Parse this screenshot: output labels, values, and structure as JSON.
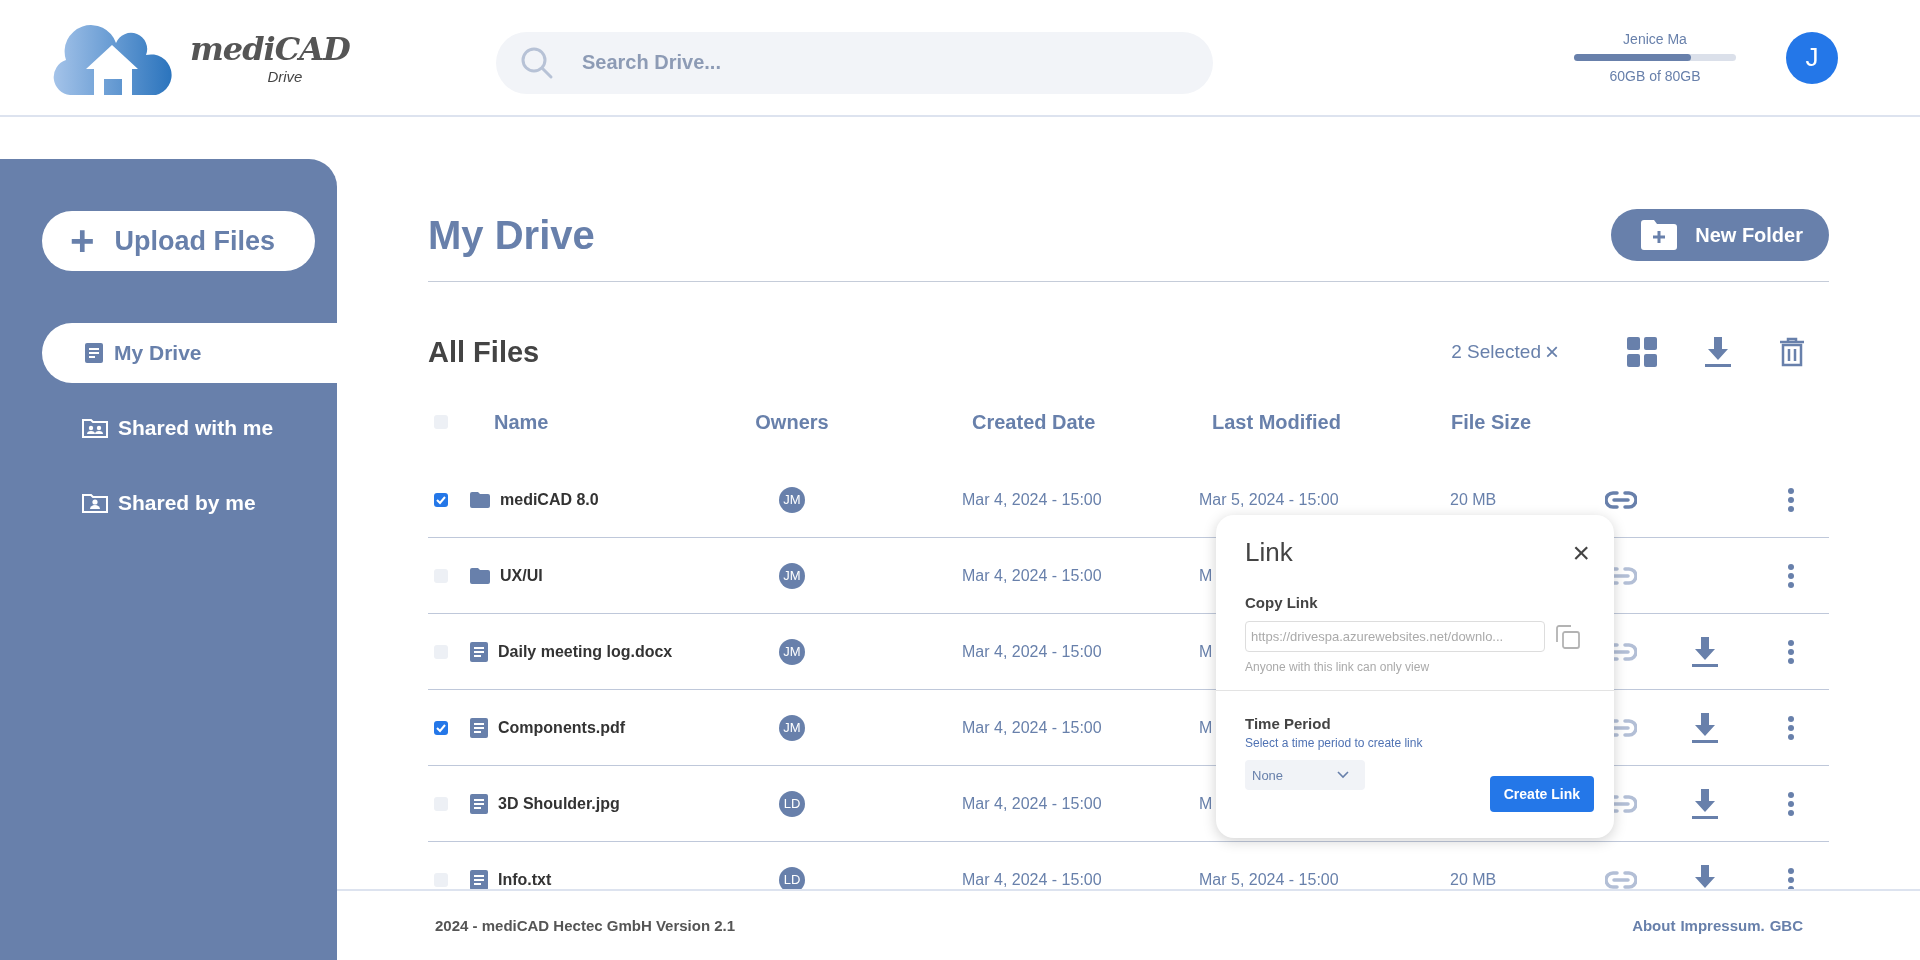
{
  "header": {
    "logo": {
      "name": "mediCAD",
      "subtitle": "Drive"
    },
    "search": {
      "placeholder": "Search Drive..."
    },
    "user": {
      "name": "Jenice Ma",
      "storage": {
        "level": 0.72
      },
      "storage_text": "60GB of 80GB",
      "avatar": "J"
    }
  },
  "sidebar": {
    "upload_button": {
      "label": "Upload Files",
      "icon": "+"
    },
    "items": [
      {
        "label": "My Drive",
        "kind": "document",
        "selected": true
      },
      {
        "label": "Shared with me",
        "kind": "shared-with",
        "selected": false
      },
      {
        "label": "Shared by me",
        "kind": "shared-by",
        "selected": false
      }
    ]
  },
  "page": {
    "title": "My Drive",
    "new_folder_button": "New Folder"
  },
  "files": {
    "title": "All Files",
    "selection": {
      "text": "2 Selected",
      "clear": "×"
    },
    "columns": [
      "Name",
      "Owners",
      "Created Date",
      "Last Modified",
      "File Size"
    ],
    "header_checked": false,
    "rows": [
      {
        "checked": true,
        "kind": "folder",
        "name": "mediCAD 8.0",
        "owner": "JM",
        "created": "Mar 4, 2024 - 15:00",
        "modified": "Mar 5, 2024 - 15:00",
        "size": "20 MB",
        "link_active": true,
        "download": false
      },
      {
        "checked": false,
        "kind": "folder",
        "name": "UX/UI",
        "owner": "JM",
        "created": "Mar 4, 2024 - 15:00",
        "modified": "M",
        "link_active": false,
        "download": false
      },
      {
        "checked": false,
        "kind": "document",
        "name": "Daily meeting log.docx",
        "owner": "JM",
        "created": "Mar 4, 2024 - 15:00",
        "modified": "M",
        "link_active": false,
        "download": true
      },
      {
        "checked": true,
        "kind": "document",
        "name": "Components.pdf",
        "owner": "JM",
        "created": "Mar 4, 2024 - 15:00",
        "modified": "M",
        "link_active": false,
        "download": true
      },
      {
        "checked": false,
        "kind": "document",
        "name": "3D Shoulder.jpg",
        "owner": "LD",
        "created": "Mar 4, 2024 - 15:00",
        "modified": "M",
        "link_active": false,
        "download": true
      },
      {
        "checked": false,
        "kind": "document",
        "name": "Info.txt",
        "owner": "LD",
        "created": "Mar 4, 2024 - 15:00",
        "modified": "Mar 5, 2024 - 15:00",
        "size": "20 MB",
        "link_active": false,
        "download": true
      }
    ]
  },
  "link_dialog": {
    "title": "Link",
    "close": "×",
    "copy_label": "Copy Link",
    "url": "https://drivespa.azurewebsites.net/downlo...",
    "hint": "Anyone with this link can only view",
    "period_label": "Time Period",
    "period_hint": "Select a time period to create link",
    "period_value": "None",
    "create_button": "Create Link"
  },
  "footer": {
    "left": "2024 - mediCAD Hectec GmbH Version 2.1",
    "links": [
      "About",
      "Impressum.",
      "GBC"
    ]
  }
}
